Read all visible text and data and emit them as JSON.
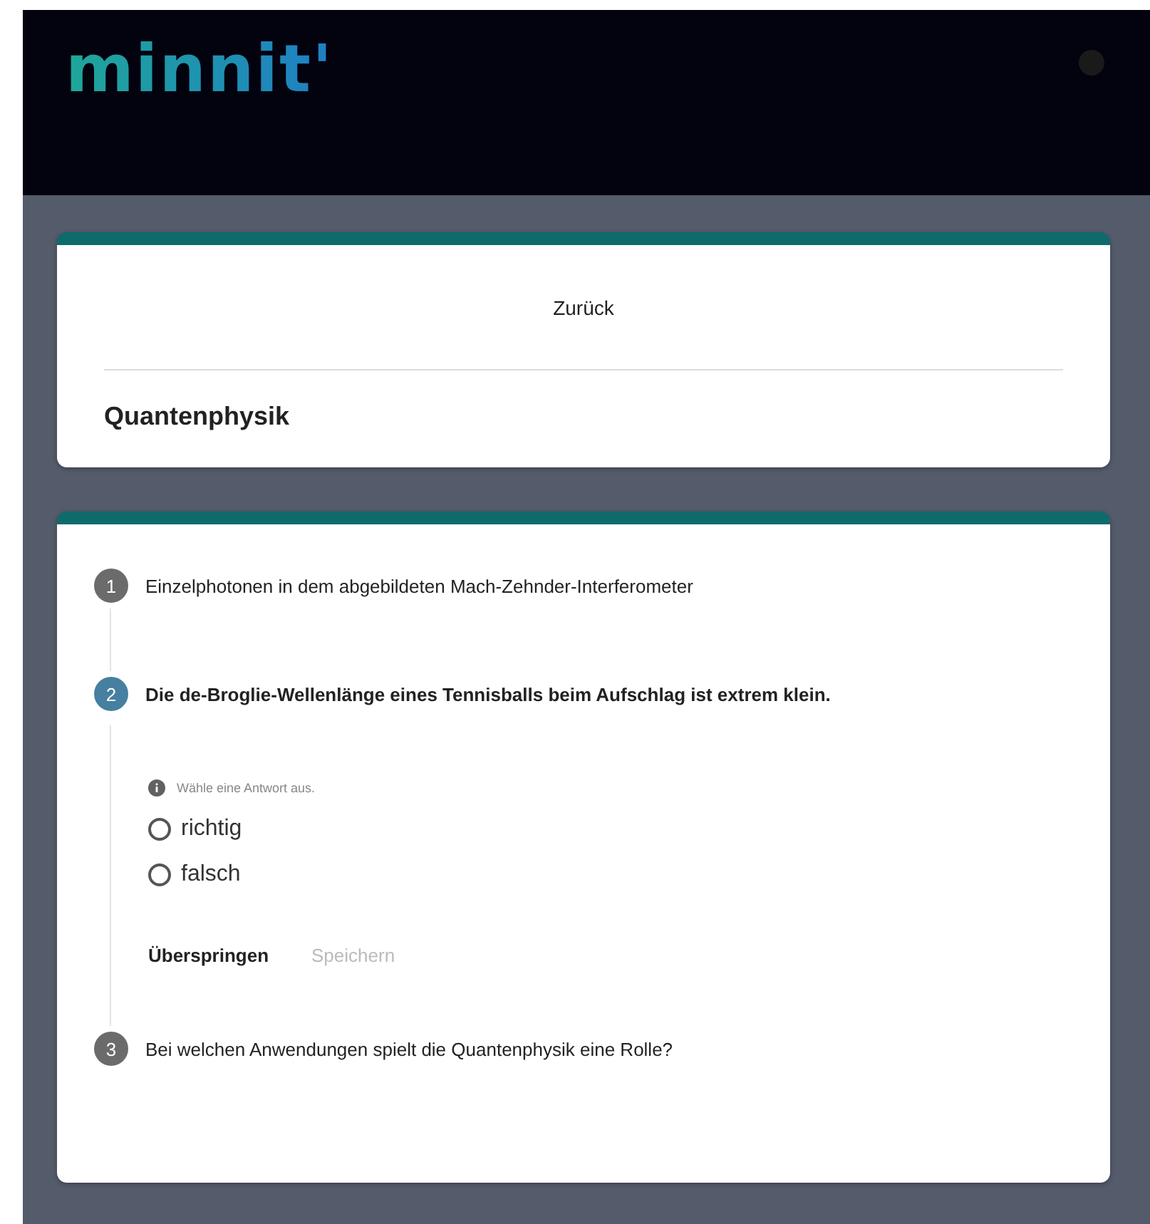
{
  "header": {
    "logo": "minnit'"
  },
  "course_card": {
    "back_link": "Zurück",
    "title": "Quantenphysik"
  },
  "steps": [
    {
      "number": "1",
      "title": "Einzelphotonen in dem abgebildeten Mach-Zehnder-Interferometer",
      "selected": false
    },
    {
      "number": "2",
      "title": "Die de-Broglie-Wellenlänge eines Tennisballs beim Aufschlag ist extrem klein.",
      "selected": true,
      "hint": "Wähle eine Antwort aus.",
      "options": [
        {
          "label": "richtig",
          "selected": false
        },
        {
          "label": "falsch",
          "selected": false
        }
      ],
      "buttons": [
        {
          "label": "Überspringen",
          "disabled": false
        },
        {
          "label": "Speichern",
          "disabled": true
        }
      ]
    },
    {
      "number": "3",
      "title": "Bei welchen Anwendungen spielt die Quantenphysik eine Rolle?",
      "selected": false
    }
  ]
}
